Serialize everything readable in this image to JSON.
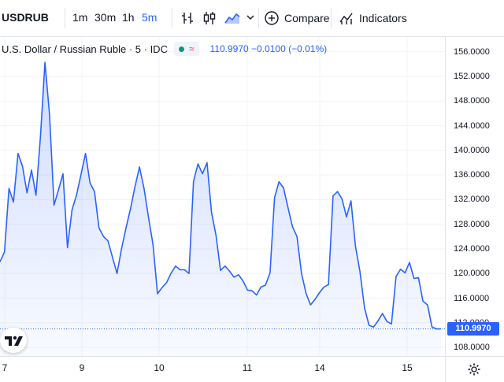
{
  "toolbar": {
    "symbol": "USDRUB",
    "intervals": [
      "1m",
      "30m",
      "1h",
      "5m"
    ],
    "active_interval": "5m",
    "compare_label": "Compare",
    "indicators_label": "Indicators",
    "icons": [
      "bar-type-icon",
      "candles-icon",
      "area-icon",
      "chevron-down-icon",
      "plus-circle-icon",
      "indicators-icon"
    ]
  },
  "legend": {
    "name": "U.S. Dollar / Russian Ruble · 5 · IDC",
    "values": "110.9970 −0.0100 (−0.01%)"
  },
  "price_scale": {
    "ticks": [
      "156.0000",
      "152.0000",
      "148.0000",
      "144.0000",
      "140.0000",
      "136.0000",
      "132.0000",
      "128.0000",
      "124.0000",
      "120.0000",
      "116.0000",
      "112.0000",
      "108.0000"
    ],
    "last_price": "110.9970"
  },
  "time_scale": {
    "ticks": [
      "7",
      "9",
      "10",
      "11",
      "14",
      "15"
    ]
  },
  "colors": {
    "accent": "#2962ff",
    "line": "#2962ff",
    "area_top": "#dfe7fd",
    "up_dot": "#089981",
    "down": "#f23645"
  },
  "chart_data": {
    "type": "area",
    "ylim": [
      106.6,
      158.4
    ],
    "x_ticks": [
      "7",
      "9",
      "10",
      "11",
      "14",
      "15"
    ],
    "last_value": 110.997,
    "series": [
      {
        "values": [
          121.9,
          123.5,
          133.8,
          131.6,
          139.5,
          137.4,
          133.1,
          136.8,
          132.7,
          142.3,
          154.3,
          145.8,
          131.1,
          133.6,
          136.2,
          124.2,
          130.3,
          132.7,
          136.1,
          139.5,
          134.7,
          133.3,
          127.4,
          126.0,
          125.3,
          122.6,
          120.0,
          124.0,
          127.4,
          130.5,
          134.1,
          137.3,
          133.8,
          129.1,
          124.7,
          116.7,
          117.7,
          118.5,
          120.0,
          121.2,
          120.6,
          120.6,
          120.0,
          134.9,
          137.8,
          136.2,
          138.0,
          129.9,
          126.2,
          120.5,
          121.2,
          120.4,
          119.4,
          119.8,
          118.8,
          117.3,
          117.2,
          116.5,
          117.8,
          118.1,
          120.1,
          132.3,
          134.9,
          133.9,
          130.7,
          127.6,
          126.0,
          120.0,
          116.8,
          114.9,
          115.8,
          116.9,
          117.8,
          118.2,
          132.6,
          133.3,
          132.1,
          129.2,
          131.8,
          124.4,
          120.3,
          114.4,
          111.6,
          111.3,
          112.3,
          113.5,
          112.2,
          111.8,
          119.5,
          120.7,
          120.1,
          121.8,
          119.2,
          119.3,
          115.5,
          114.9,
          111.3,
          111.0,
          110.997
        ]
      }
    ]
  }
}
